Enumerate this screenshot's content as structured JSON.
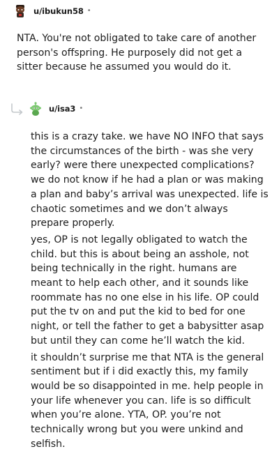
{
  "comments": [
    {
      "username": "u/ibukun58",
      "dot": "•",
      "avatar_icon": "snoo-avatar-icon",
      "paragraphs": [
        "NTA. You're not obligated to take care of another person's offspring. He purposely did not get a sitter because he assumed you would do it."
      ]
    },
    {
      "username": "u/isa3",
      "dot": "•",
      "avatar_icon": "snoo-avatar-icon",
      "reply_icon": "reply-arrow-icon",
      "paragraphs": [
        "this is a crazy take. we have NO INFO that says the circumstances of the birth - was she very early? were there unexpected complications? we do not know if he had a plan or was making a plan and baby’s arrival was unexpected. life is chaotic sometimes and we don’t always prepare properly.",
        "yes, OP is not legally obligated to watch the child. but this is about being an asshole, not being technically in the right. humans are meant to help each other, and it sounds like roommate has no one else in his life. OP could put the tv on and put the kid to bed for one night, or tell the father to get a babysitter asap but until they can come he’ll watch the kid.",
        "it shouldn’t surprise me that NTA is the general sentiment but if i did exactly this, my family would be so disappointed in me. help people in your life whenever you can. life is so difficult when you’re alone. YTA, OP. you’re not technically wrong but you were unkind and selfish."
      ]
    }
  ],
  "colors": {
    "text": "#1c1c1c",
    "meta": "#7c7c7c",
    "reply_arrow": "#c4c8cc",
    "avatar2_green": "#7bc96f"
  }
}
